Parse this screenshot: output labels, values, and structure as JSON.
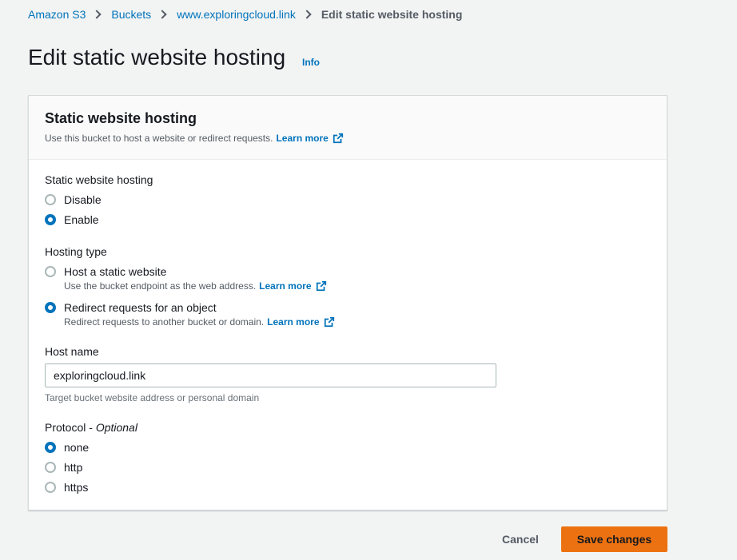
{
  "breadcrumb": {
    "items": [
      "Amazon S3",
      "Buckets",
      "www.exploringcloud.link"
    ],
    "current": "Edit static website hosting"
  },
  "page": {
    "title": "Edit static website hosting",
    "info": "Info"
  },
  "panel": {
    "title": "Static website hosting",
    "description": "Use this bucket to host a website or redirect requests.",
    "learn_more": "Learn more"
  },
  "hosting": {
    "label": "Static website hosting",
    "options": [
      "Disable",
      "Enable"
    ],
    "selected": "Enable"
  },
  "hosting_type": {
    "label": "Hosting type",
    "options": [
      {
        "label": "Host a static website",
        "desc": "Use the bucket endpoint as the web address.",
        "learn_more": "Learn more"
      },
      {
        "label": "Redirect requests for an object",
        "desc": "Redirect requests to another bucket or domain.",
        "learn_more": "Learn more"
      }
    ],
    "selected": "Redirect requests for an object"
  },
  "host_name": {
    "label": "Host name",
    "value": "exploringcloud.link",
    "hint": "Target bucket website address or personal domain"
  },
  "protocol": {
    "label": "Protocol - ",
    "optional": "Optional",
    "options": [
      "none",
      "http",
      "https"
    ],
    "selected": "none"
  },
  "actions": {
    "cancel": "Cancel",
    "save": "Save changes"
  },
  "colors": {
    "link": "#0073bb",
    "primary": "#ec7211",
    "background": "#f2f3f3"
  }
}
